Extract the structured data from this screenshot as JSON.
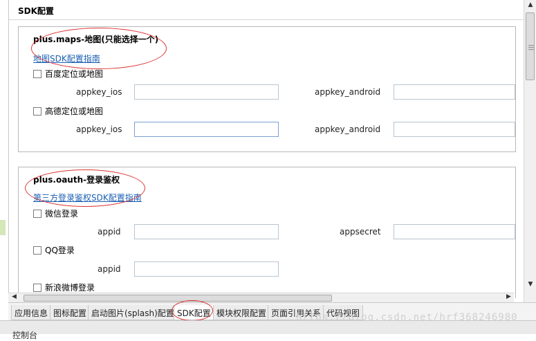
{
  "editor": {
    "title": "SDK配置"
  },
  "maps": {
    "title": "plus.maps-地图(只能选择一个)",
    "guide_link": "地图SDK配置指南",
    "baidu": {
      "label": "百度定位或地图",
      "appkey_ios_label": "appkey_ios",
      "appkey_android_label": "appkey_android",
      "appkey_ios_value": "",
      "appkey_android_value": ""
    },
    "amap": {
      "label": "高德定位或地图",
      "appkey_ios_label": "appkey_ios",
      "appkey_android_label": "appkey_android",
      "appkey_ios_value": "",
      "appkey_android_value": ""
    }
  },
  "oauth": {
    "title": "plus.oauth-登录鉴权",
    "guide_link": "第三方登录鉴权SDK配置指南",
    "weixin": {
      "label": "微信登录",
      "appid_label": "appid",
      "appsecret_label": "appsecret",
      "appid_value": "",
      "appsecret_value": ""
    },
    "qq": {
      "label": "QQ登录",
      "appid_label": "appid",
      "appid_value": ""
    },
    "sina": {
      "label": "新浪微博登录"
    }
  },
  "tabs": [
    {
      "label": "应用信息"
    },
    {
      "label": "图标配置"
    },
    {
      "label": "启动图片(splash)配置"
    },
    {
      "label": "SDK配置"
    },
    {
      "label": "模块权限配置"
    },
    {
      "label": "页面引用关系"
    },
    {
      "label": "代码视图"
    }
  ],
  "active_tab": "SDK配置",
  "watermark": "https://blog.csdn.net/hrf368246980",
  "console": {
    "label": "控制台"
  },
  "scroll_icons": {
    "up": "arrow-up-icon",
    "down": "arrow-down-icon",
    "left": "arrow-left-icon",
    "right": "arrow-right-icon"
  }
}
